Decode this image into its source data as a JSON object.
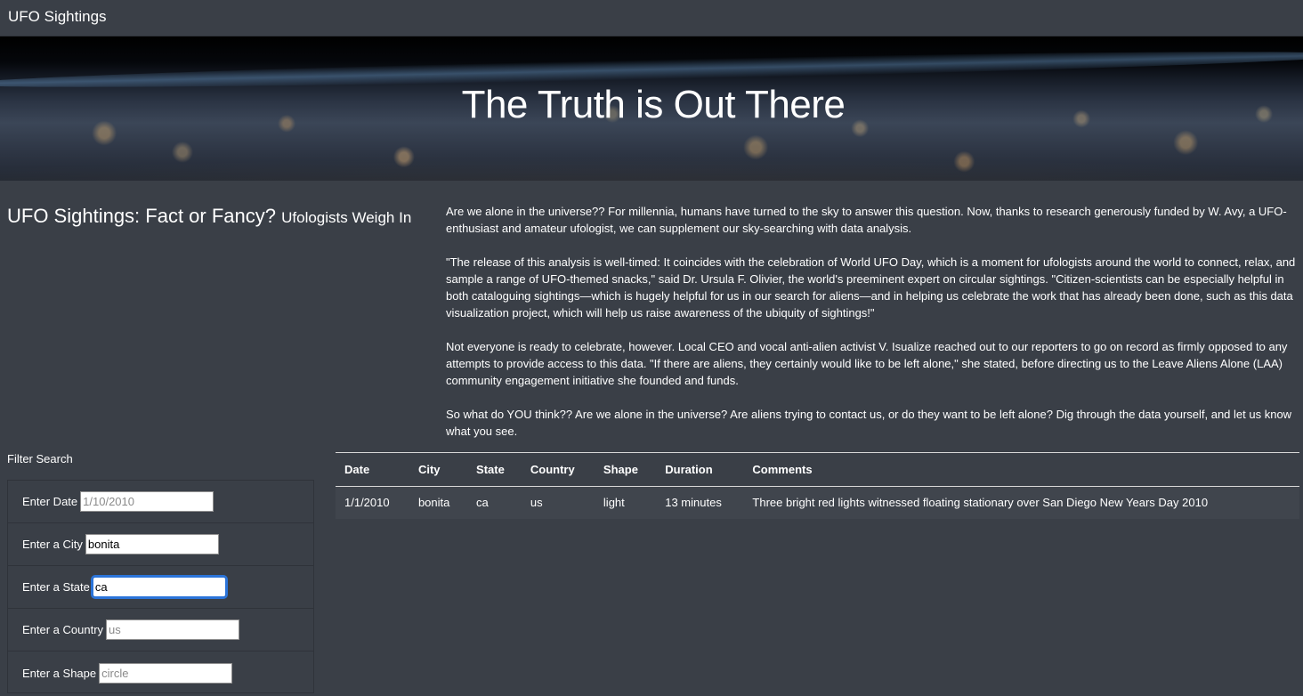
{
  "navbar": {
    "brand": "UFO Sightings"
  },
  "hero": {
    "title": "The Truth is Out There"
  },
  "intro": {
    "title": "UFO Sightings: Fact or Fancy?",
    "subtitle": "Ufologists Weigh In",
    "paragraphs": [
      "Are we alone in the universe?? For millennia, humans have turned to the sky to answer this question. Now, thanks to research generously funded by W. Avy, a UFO-enthusiast and amateur ufologist, we can supplement our sky-searching with data analysis.",
      "\"The release of this analysis is well-timed: It coincides with the celebration of World UFO Day, which is a moment for ufologists around the world to connect, relax, and sample a range of UFO-themed snacks,\" said Dr. Ursula F. Olivier, the world's preeminent expert on circular sightings. \"Citizen-scientists can be especially helpful in both cataloguing sightings—which is hugely helpful for us in our search for aliens—and in helping us celebrate the work that has already been done, such as this data visualization project, which will help us raise awareness of the ubiquity of sightings!\"",
      "Not everyone is ready to celebrate, however. Local CEO and vocal anti-alien activist V. Isualize reached out to our reporters to go on record as firmly opposed to any attempts to provide access to this data. \"If there are aliens, they certainly would like to be left alone,\" she stated, before directing us to the Leave Aliens Alone (LAA) community engagement initiative she founded and funds.",
      "So what do YOU think?? Are we alone in the universe? Are aliens trying to contact us, or do they want to be left alone? Dig through the data yourself, and let us know what you see."
    ]
  },
  "filters": {
    "heading": "Filter Search",
    "date": {
      "label": "Enter Date",
      "value": "",
      "placeholder": "1/10/2010"
    },
    "city": {
      "label": "Enter a City",
      "value": "bonita",
      "placeholder": ""
    },
    "state": {
      "label": "Enter a State",
      "value": "ca",
      "placeholder": ""
    },
    "country": {
      "label": "Enter a Country",
      "value": "",
      "placeholder": "us"
    },
    "shape": {
      "label": "Enter a Shape",
      "value": "",
      "placeholder": "circle"
    }
  },
  "table": {
    "columns": [
      "Date",
      "City",
      "State",
      "Country",
      "Shape",
      "Duration",
      "Comments"
    ],
    "rows": [
      [
        "1/1/2010",
        "bonita",
        "ca",
        "us",
        "light",
        "13 minutes",
        "Three bright red lights witnessed floating stationary over San Diego New Years Day 2010"
      ]
    ]
  }
}
